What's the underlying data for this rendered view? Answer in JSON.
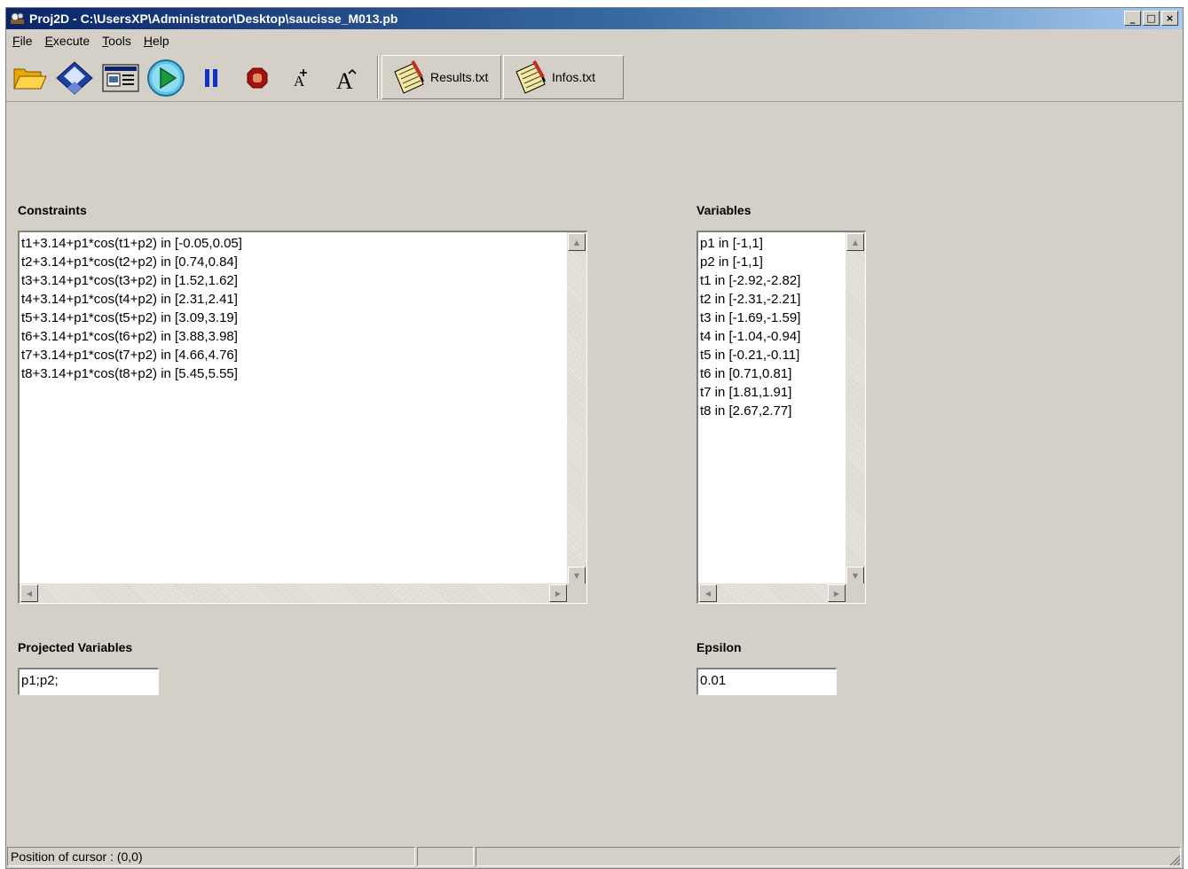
{
  "window": {
    "title": "Proj2D - C:\\UsersXP\\Administrator\\Desktop\\saucisse_M013.pb",
    "controls": {
      "minimize": "_",
      "maximize": "□",
      "close": "×"
    }
  },
  "menu": [
    {
      "label": "File",
      "accel": "F",
      "rest": "ile"
    },
    {
      "label": "Execute",
      "accel": "E",
      "rest": "xecute"
    },
    {
      "label": "Tools",
      "accel": "T",
      "rest": "ools"
    },
    {
      "label": "Help",
      "accel": "H",
      "rest": "elp"
    }
  ],
  "toolbar": {
    "icons": [
      "open-folder-icon",
      "save-disk-icon",
      "window-icon",
      "play-icon",
      "pause-icon",
      "stop-icon",
      "font-increase-icon",
      "font-decrease-icon"
    ],
    "results_label": "Results.txt",
    "infos_label": "Infos.txt",
    "font_small_glyph": "A",
    "font_large_glyph": "A"
  },
  "constraints": {
    "label": "Constraints",
    "lines": [
      "t1+3.14+p1*cos(t1+p2) in [-0.05,0.05]",
      "t2+3.14+p1*cos(t2+p2) in [0.74,0.84]",
      "t3+3.14+p1*cos(t3+p2) in [1.52,1.62]",
      "t4+3.14+p1*cos(t4+p2) in [2.31,2.41]",
      "t5+3.14+p1*cos(t5+p2) in [3.09,3.19]",
      "t6+3.14+p1*cos(t6+p2) in [3.88,3.98]",
      "t7+3.14+p1*cos(t7+p2) in [4.66,4.76]",
      "t8+3.14+p1*cos(t8+p2) in [5.45,5.55]"
    ]
  },
  "variables": {
    "label": "Variables",
    "lines": [
      "p1 in [-1,1]",
      "p2 in [-1,1]",
      "t1 in [-2.92,-2.82]",
      "t2 in [-2.31,-2.21]",
      "t3 in [-1.69,-1.59]",
      "t4 in [-1.04,-0.94]",
      "t5 in [-0.21,-0.11]",
      "t6 in [0.71,0.81]",
      "t7 in [1.81,1.91]",
      "t8 in [2.67,2.77]"
    ]
  },
  "projected": {
    "label": "Projected Variables",
    "value": "p1;p2;"
  },
  "epsilon": {
    "label": "Epsilon",
    "value": "0.01"
  },
  "status": {
    "cursor": "Position of cursor : (0,0)",
    "pane2": "",
    "pane3": ""
  },
  "scroll_arrows": {
    "up": "▲",
    "down": "▼",
    "left": "◀",
    "right": "▶"
  }
}
